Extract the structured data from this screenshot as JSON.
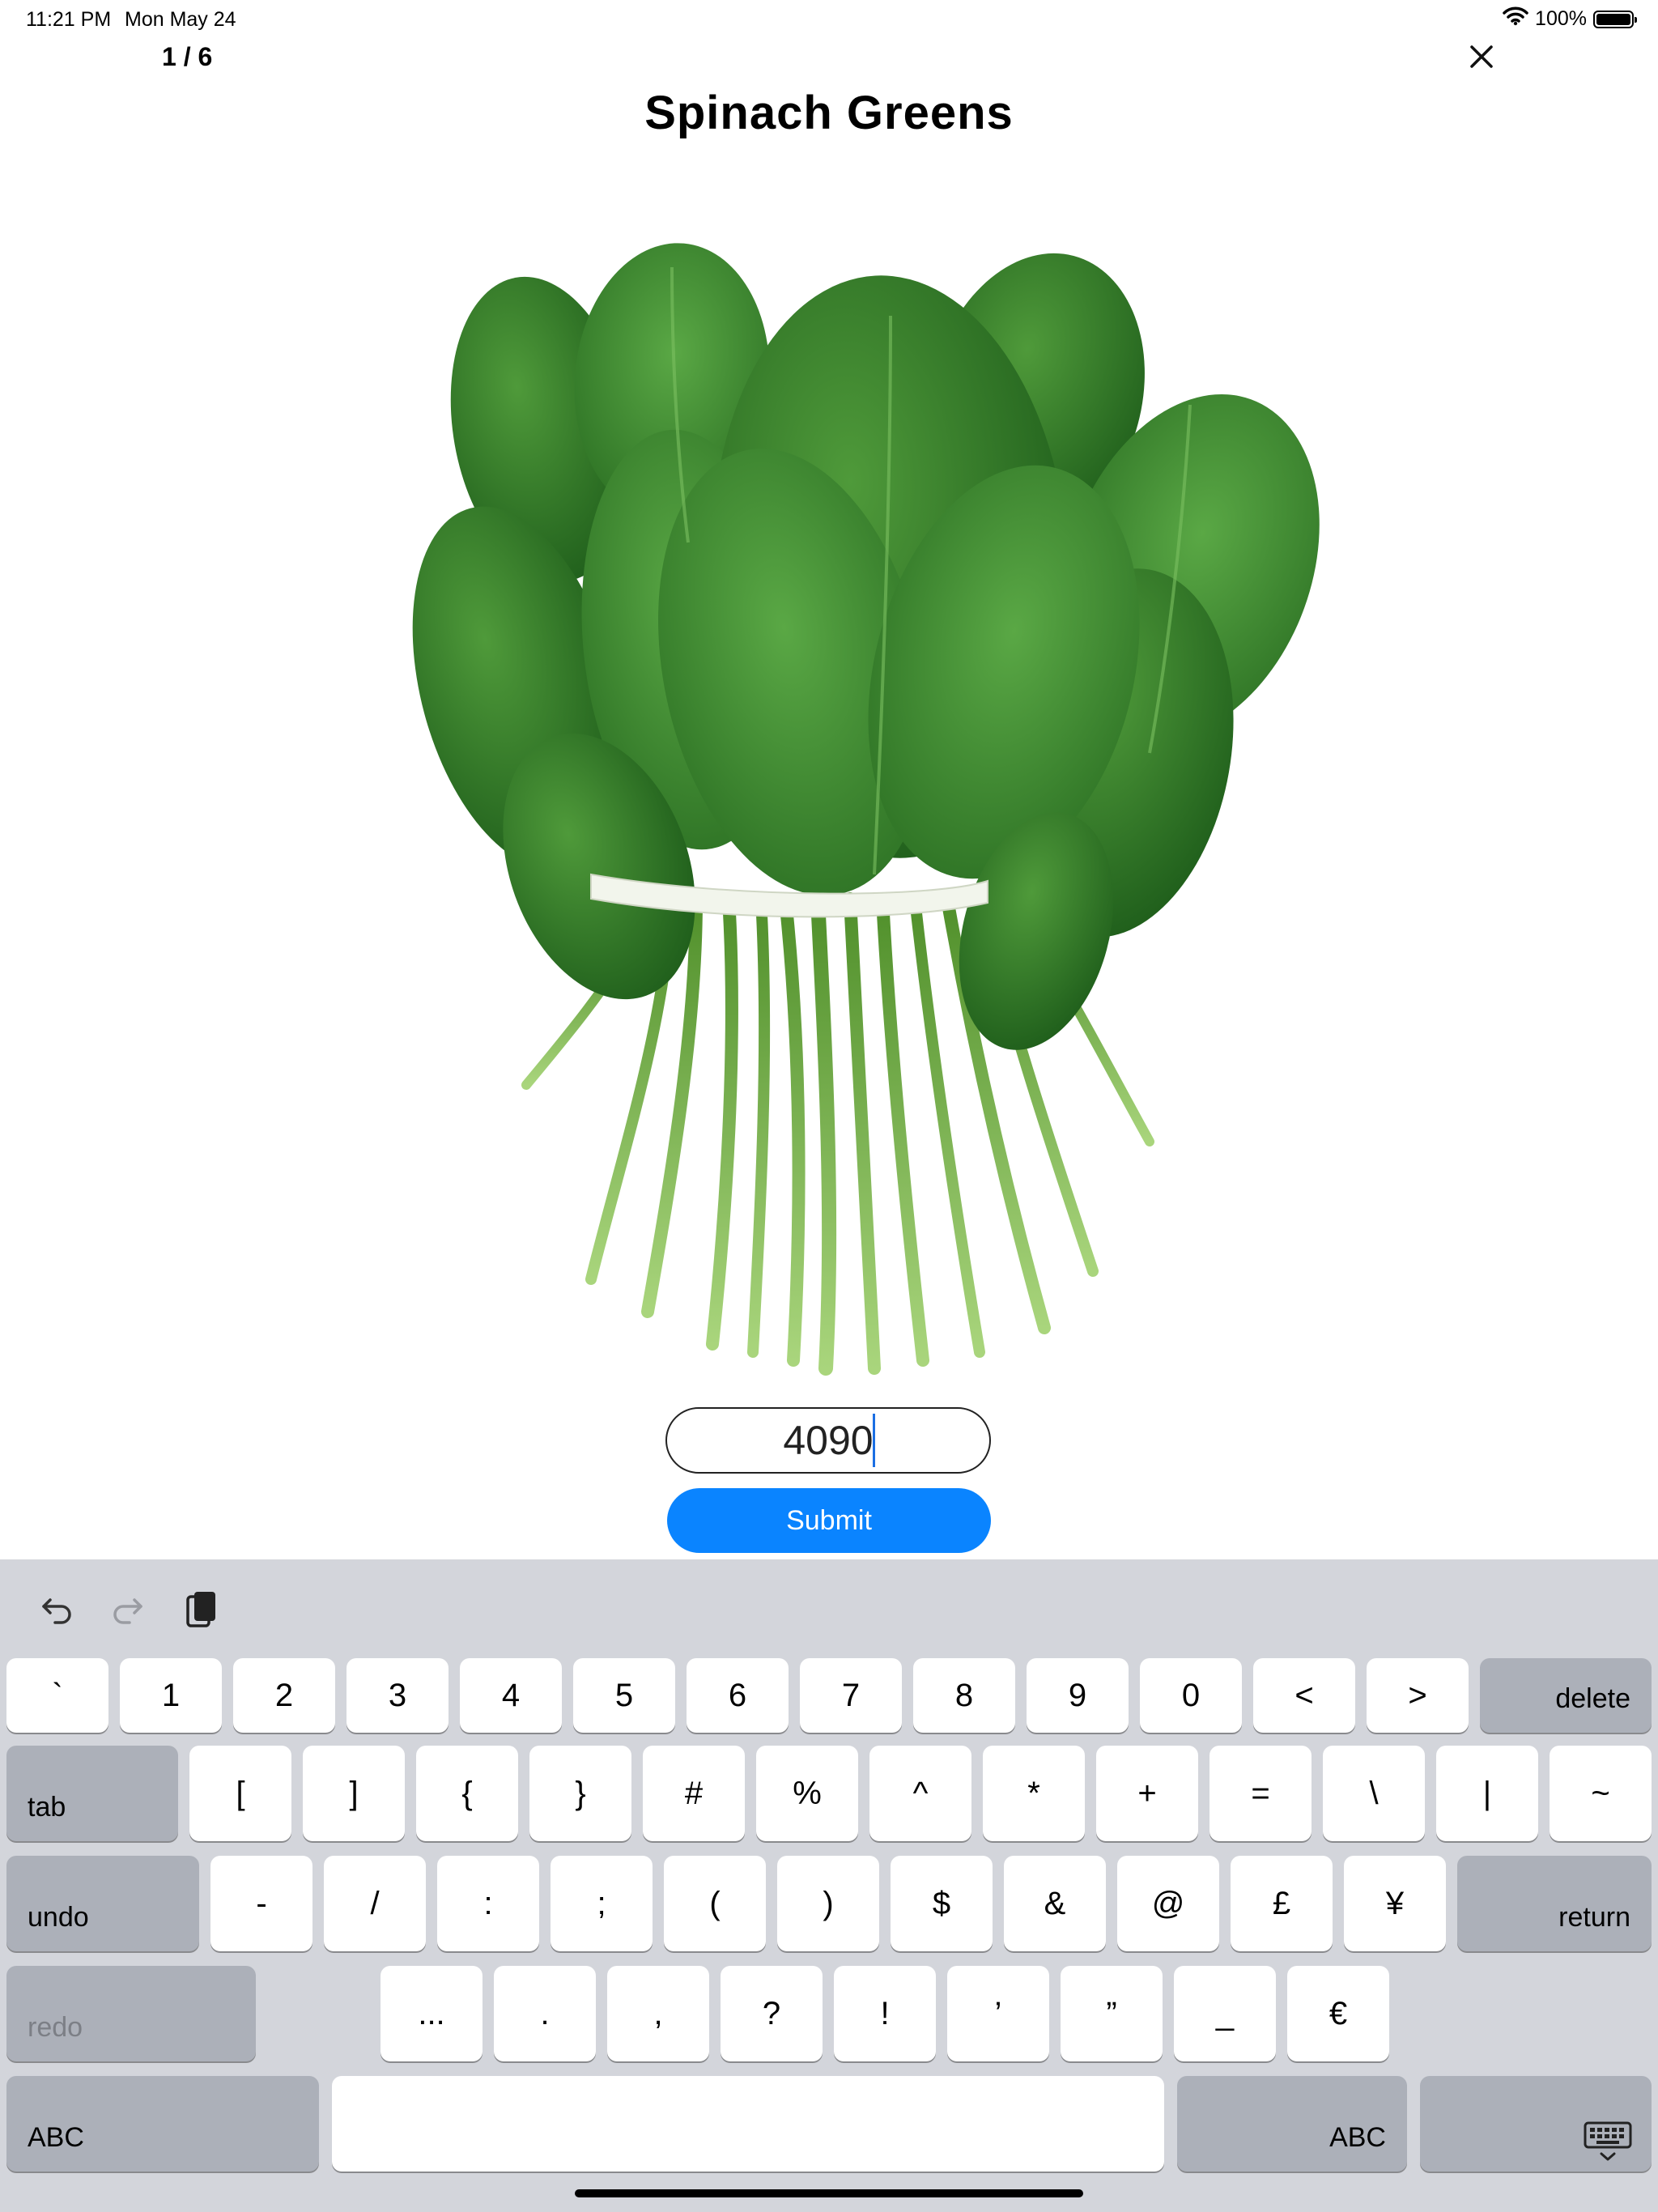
{
  "status": {
    "time": "11:21 PM",
    "date": "Mon May 24",
    "battery": "100%"
  },
  "counter": "1 / 6",
  "title": "Spinach Greens",
  "quantity": {
    "value": "4090"
  },
  "submit_label": "Submit",
  "keyboard": {
    "row1": [
      "`",
      "1",
      "2",
      "3",
      "4",
      "5",
      "6",
      "7",
      "8",
      "9",
      "0",
      "<",
      ">"
    ],
    "delete": "delete",
    "tab": "tab",
    "row2": [
      "[",
      "]",
      "{",
      "}",
      "#",
      "%",
      "^",
      "*",
      "+",
      "=",
      "\\",
      "|",
      "~"
    ],
    "undo": "undo",
    "row3": [
      "-",
      "/",
      ":",
      ";",
      "(",
      ")",
      "$",
      "&",
      "@",
      "£",
      "¥"
    ],
    "return": "return",
    "redo": "redo",
    "row4": [
      "...",
      ".",
      ",",
      "?",
      "!",
      "’",
      "”",
      "_",
      "€"
    ],
    "abc_left": "ABC",
    "abc_right": "ABC"
  }
}
